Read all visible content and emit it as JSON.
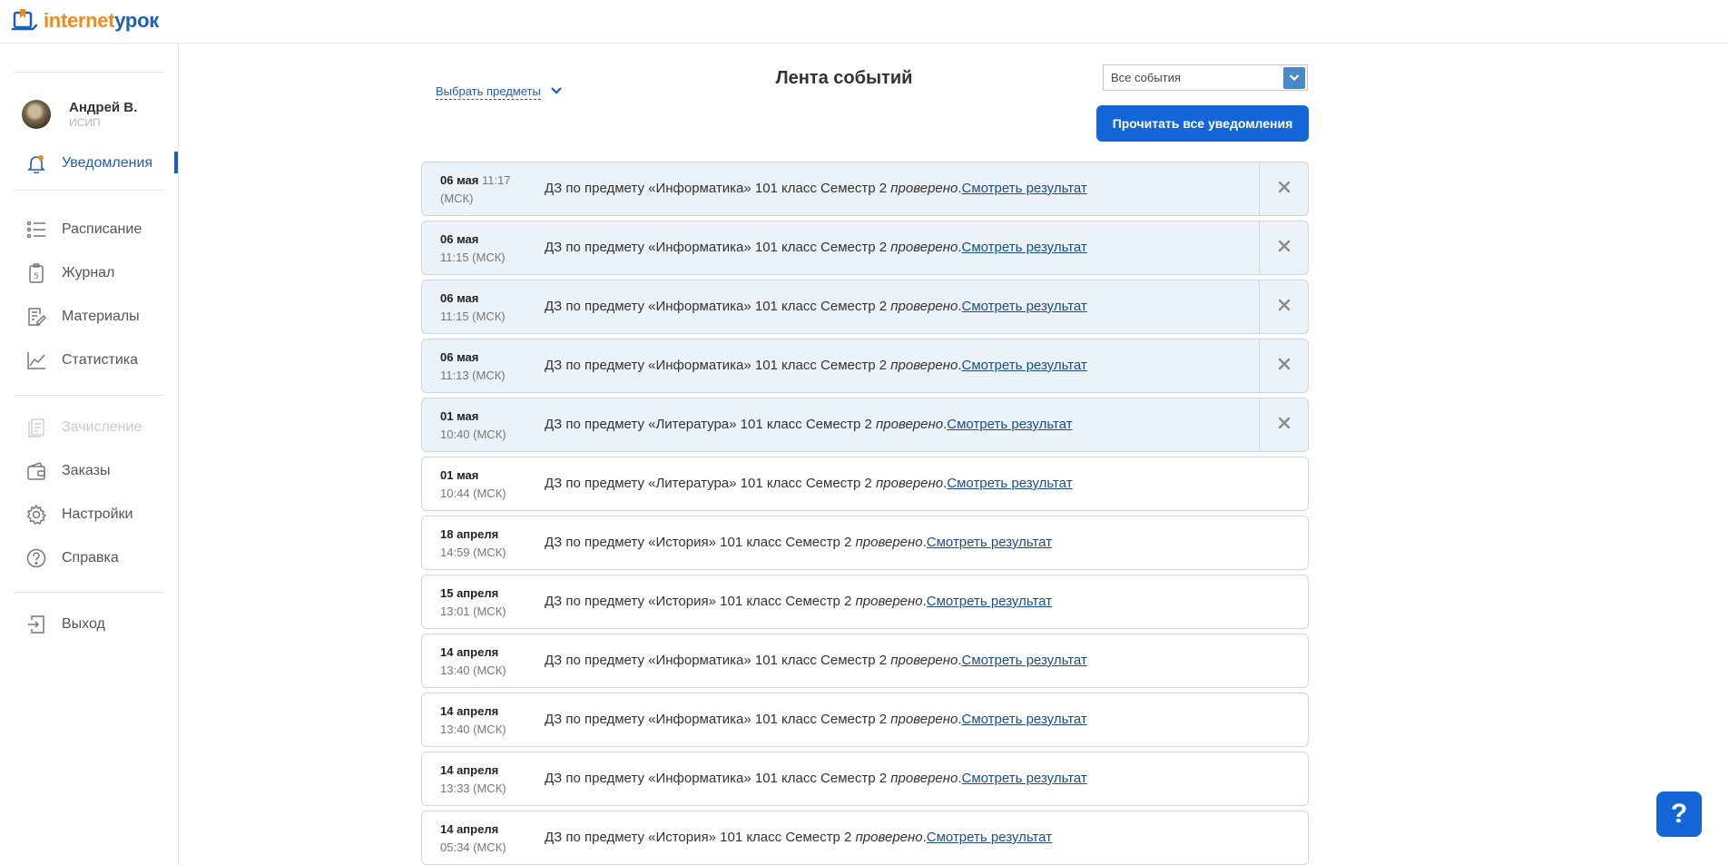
{
  "logo": {
    "part1": "internet",
    "part2": "урок"
  },
  "user": {
    "name": "Андрей В.",
    "group": "ИСИП"
  },
  "nav": {
    "notifications": "Уведомления",
    "schedule": "Расписание",
    "journal": "Журнал",
    "materials": "Материалы",
    "stats": "Статистика",
    "enrollment": "Зачисление",
    "orders": "Заказы",
    "settings": "Настройки",
    "help": "Справка",
    "logout": "Выход"
  },
  "header": {
    "filter_label": "Выбрать предметы",
    "title": "Лента событий",
    "select_value": "Все события",
    "read_all": "Прочитать все уведомления"
  },
  "feed": [
    {
      "date": "06 мая",
      "time": "11:17 (МСК)",
      "text": "ДЗ по предмету «Информатика» 101 класс Семестр 2 ",
      "status": "проверено",
      "link": "Смотреть результат",
      "unread": true,
      "inline_time": true
    },
    {
      "date": "06 мая",
      "time": "11:15 (МСК)",
      "text": "ДЗ по предмету «Информатика» 101 класс Семестр 2 ",
      "status": "проверено",
      "link": "Смотреть результат",
      "unread": true
    },
    {
      "date": "06 мая",
      "time": "11:15 (МСК)",
      "text": "ДЗ по предмету «Информатика» 101 класс Семестр 2 ",
      "status": "проверено",
      "link": "Смотреть результат",
      "unread": true
    },
    {
      "date": "06 мая",
      "time": "11:13 (МСК)",
      "text": "ДЗ по предмету «Информатика» 101 класс Семестр 2 ",
      "status": "проверено",
      "link": "Смотреть результат",
      "unread": true
    },
    {
      "date": "01 мая",
      "time": "10:40 (МСК)",
      "text": "ДЗ по предмету «Литература» 101 класс Семестр 2 ",
      "status": "проверено",
      "link": "Смотреть результат",
      "unread": true
    },
    {
      "date": "01 мая",
      "time": "10:44 (МСК)",
      "text": "ДЗ по предмету «Литература» 101 класс Семестр 2 ",
      "status": "проверено",
      "link": "Смотреть результат",
      "unread": false
    },
    {
      "date": "18 апреля",
      "time": "14:59 (МСК)",
      "text": "ДЗ по предмету «История» 101 класс Семестр 2 ",
      "status": "проверено",
      "link": "Смотреть результат",
      "unread": false
    },
    {
      "date": "15 апреля",
      "time": "13:01 (МСК)",
      "text": "ДЗ по предмету «История» 101 класс Семестр 2 ",
      "status": "проверено",
      "link": "Смотреть результат",
      "unread": false
    },
    {
      "date": "14 апреля",
      "time": "13:40 (МСК)",
      "text": "ДЗ по предмету «Информатика» 101 класс Семестр 2 ",
      "status": "проверено",
      "link": "Смотреть результат",
      "unread": false
    },
    {
      "date": "14 апреля",
      "time": "13:40 (МСК)",
      "text": "ДЗ по предмету «Информатика» 101 класс Семестр 2 ",
      "status": "проверено",
      "link": "Смотреть результат",
      "unread": false
    },
    {
      "date": "14 апреля",
      "time": "13:33 (МСК)",
      "text": "ДЗ по предмету «Информатика» 101 класс Семестр 2 ",
      "status": "проверено",
      "link": "Смотреть результат",
      "unread": false
    },
    {
      "date": "14 апреля",
      "time": "05:34 (МСК)",
      "text": "ДЗ по предмету «История» 101 класс Семестр 2 ",
      "status": "проверено",
      "link": "Смотреть результат",
      "unread": false
    }
  ],
  "help_button": "?",
  "colors": {
    "brand_blue": "#1466d8",
    "brand_orange": "#f08a1c",
    "unread_bg": "#ebf2f8"
  }
}
